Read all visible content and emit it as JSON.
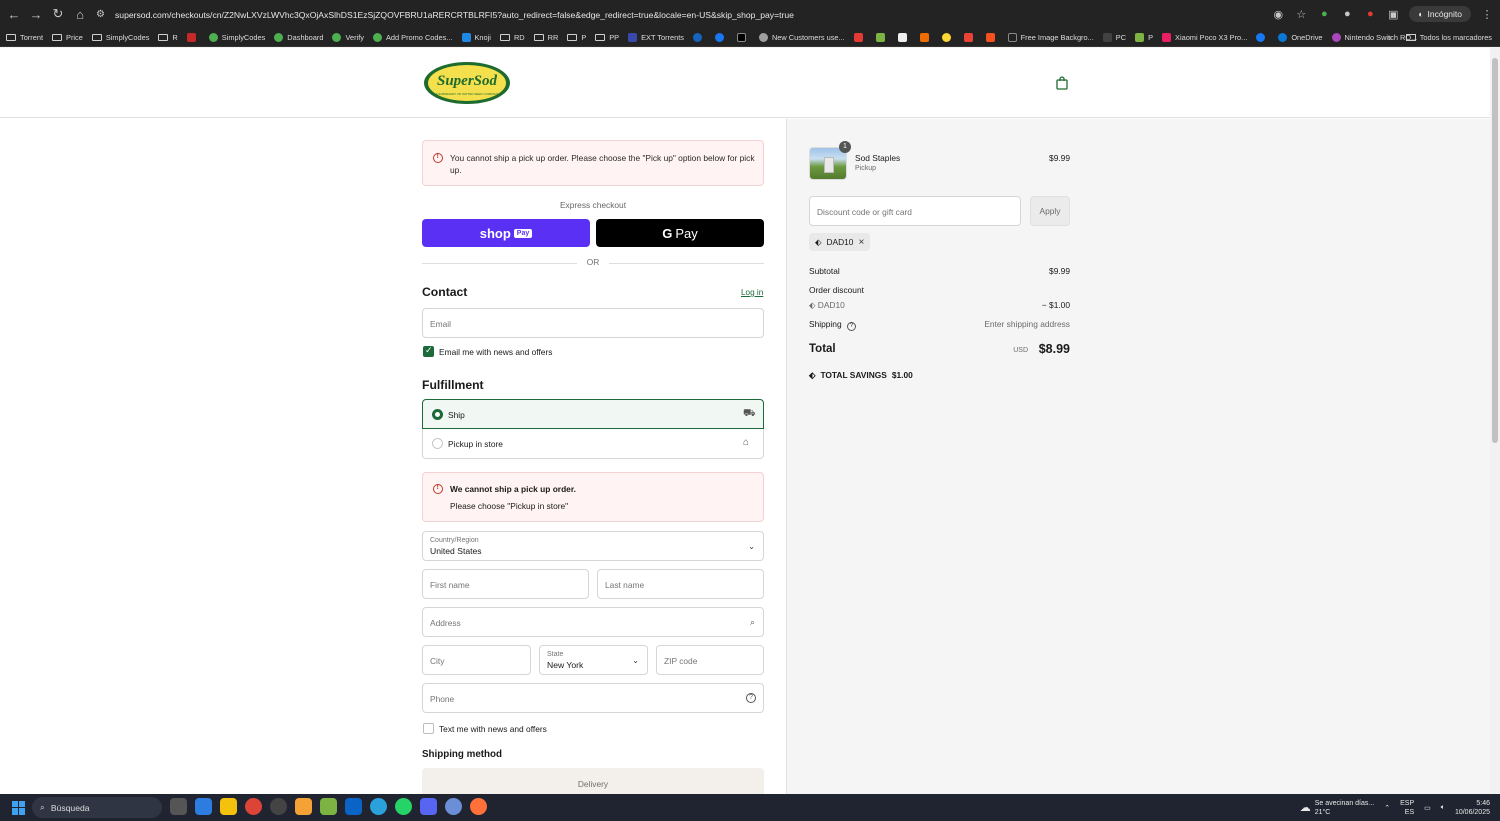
{
  "browser": {
    "url": "supersod.com/checkouts/cn/Z2NwLXVzLWVhc3QxOjAxSlhDS1EzSjZQOVFBRU1aRERCRTBLRFI5?auto_redirect=false&edge_redirect=true&locale=en-US&skip_shop_pay=true",
    "incognito_label": "Incógnito",
    "bookmarks": [
      "Torrent",
      "Price",
      "SimplyCodes",
      "R",
      "SimplyCodes",
      "Dashboard",
      "Verify",
      "Add Promo Codes...",
      "Knoji",
      "RD",
      "RR",
      "P",
      "PP",
      "EXT Torrents",
      "New Customers use...",
      "Free Image Backgro...",
      "PC",
      "P",
      "Xiaomi Poco X3 Pro...",
      "OneDrive",
      "Nintendo Switch RO..."
    ],
    "bookmarks_all": "Todos los marcadores"
  },
  "header": {
    "logo_text": "SuperSod",
    "logo_sub": "A SUBSIDIARY OF PATTEN SEED COMPANY"
  },
  "checkout": {
    "top_alert": "You cannot ship a pick up order. Please choose the \"Pick up\" option below for pick up.",
    "express_label": "Express checkout",
    "shoppay_label": "shop",
    "shoppay_badge": "Pay",
    "gpay_label": "Pay",
    "or_label": "OR",
    "contact_heading": "Contact",
    "login_label": "Log in",
    "email_placeholder": "Email",
    "email_news_label": "Email me with news and offers",
    "fulfillment_heading": "Fulfillment",
    "ship_label": "Ship",
    "pickup_label": "Pickup in store",
    "alert2_title": "We cannot ship a pick up order.",
    "alert2_text": "Please choose \"Pickup in store\"",
    "country_label": "Country/Region",
    "country_value": "United States",
    "first_name_ph": "First name",
    "last_name_ph": "Last name",
    "address_ph": "Address",
    "city_ph": "City",
    "state_label": "State",
    "state_value": "New York",
    "zip_ph": "ZIP code",
    "phone_ph": "Phone",
    "text_news_label": "Text me with news and offers",
    "shipping_method_heading": "Shipping method",
    "delivery_label": "Delivery"
  },
  "summary": {
    "product_name": "Sod Staples",
    "product_sub": "Pickup",
    "product_qty": "1",
    "product_price": "$9.99",
    "discount_placeholder": "Discount code or gift card",
    "apply_label": "Apply",
    "tag_code": "DAD10",
    "subtotal_label": "Subtotal",
    "subtotal_value": "$9.99",
    "order_discount_label": "Order discount",
    "discount_code": "DAD10",
    "discount_value": "− $1.00",
    "shipping_label": "Shipping",
    "shipping_value": "Enter shipping address",
    "total_label": "Total",
    "total_currency": "USD",
    "total_value": "$8.99",
    "savings_label": "TOTAL SAVINGS",
    "savings_value": "$1.00"
  },
  "taskbar": {
    "search_label": "Búsqueda",
    "weather_text": "Se avecinan días...",
    "weather_temp": "21°C",
    "lang": "ESP",
    "lang_sub": "ES",
    "time": "5:46",
    "date": "10/06/2025"
  }
}
